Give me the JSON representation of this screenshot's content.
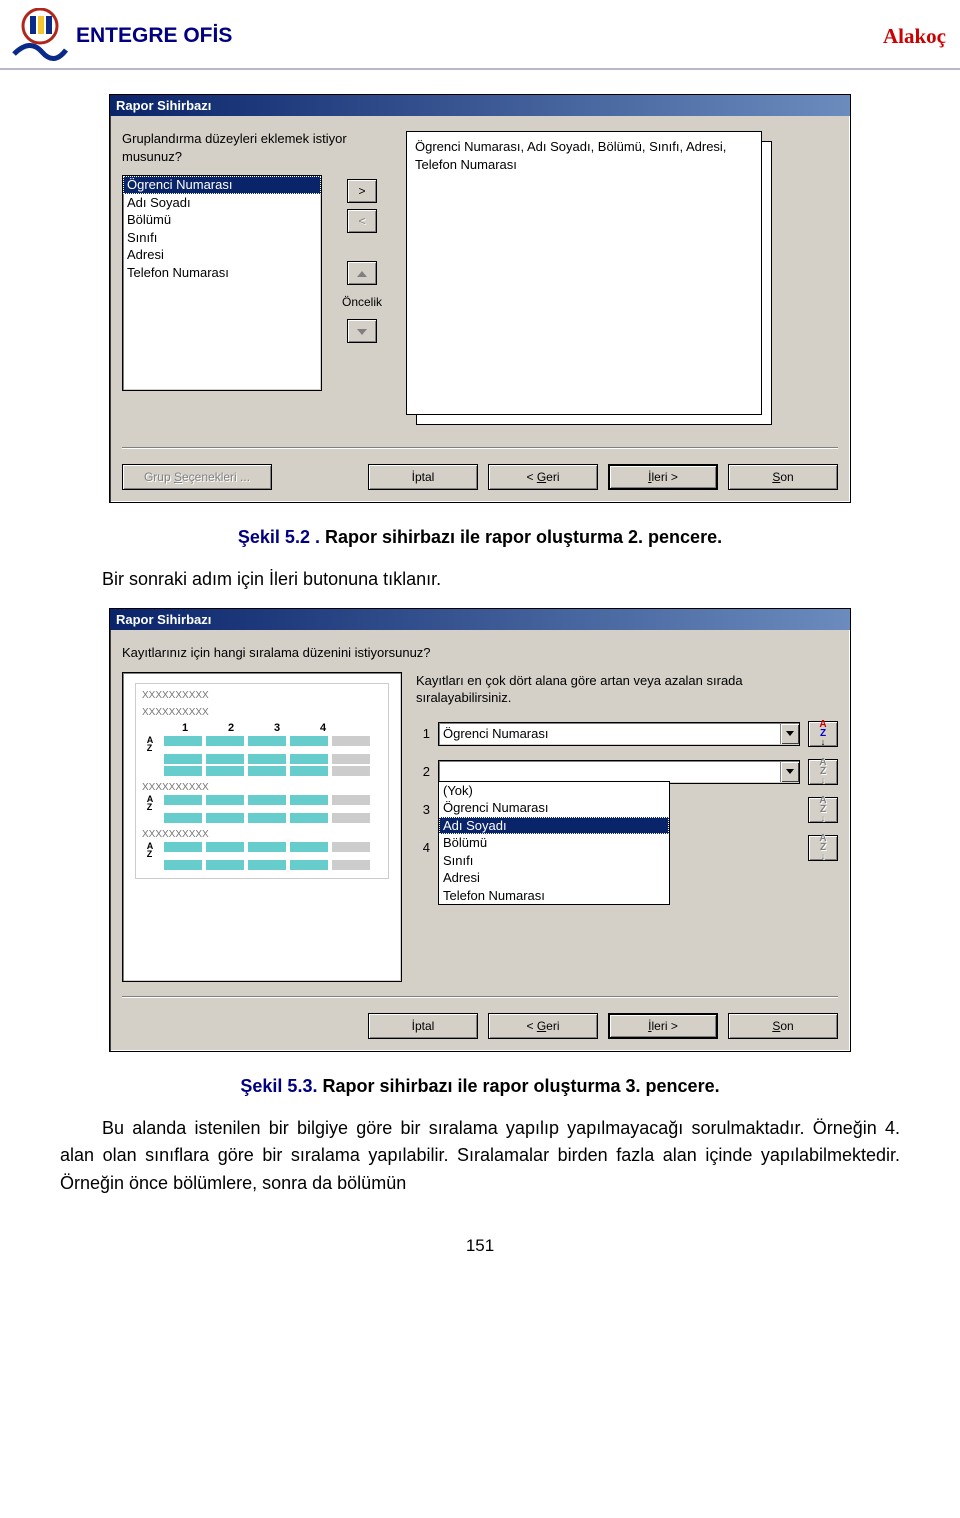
{
  "header": {
    "left": "ENTEGRE OFİS",
    "right": "Alakoç"
  },
  "dialog1": {
    "title": "Rapor Sihirbazı",
    "question": "Gruplandırma düzeyleri eklemek istiyor musunuz?",
    "fields": [
      "Ögrenci Numarası",
      "Adı Soyadı",
      "Bölümü",
      "Sınıfı",
      "Adresi",
      "Telefon Numarası"
    ],
    "preview_line": "Ögrenci Numarası, Adı Soyadı, Bölümü, Sınıfı, Adresi, Telefon Numarası",
    "priority_label": "Öncelik",
    "buttons": {
      "group_options": "Grup Seçenekleri ...",
      "cancel": "İptal",
      "back": "< Geri",
      "next": "İleri >",
      "finish": "Son"
    }
  },
  "caption1": {
    "blue": "Şekil 5.2 .",
    "rest": " Rapor sihirbazı ile rapor oluşturma 2. pencere."
  },
  "text1": "Bir sonraki adım için İleri butonuna tıklanır.",
  "dialog2": {
    "title": "Rapor Sihirbazı",
    "question": "Kayıtlarınız için hangi sıralama düzenini istiyorsunuz?",
    "hint": "Kayıtları en çok dört alana göre artan veya azalan sırada sıralayabilirsiniz.",
    "sort1_value": "Ögrenci Numarası",
    "sort2_value": "",
    "dropdown_options": [
      "(Yok)",
      "Ögrenci Numarası",
      "Adı Soyadı",
      "Bölümü",
      "Sınıfı",
      "Adresi",
      "Telefon Numarası"
    ],
    "dropdown_selected": "Adı Soyadı",
    "preview_placeholder": "XXXXXXXXXX",
    "buttons": {
      "cancel": "İptal",
      "back": "< Geri",
      "next": "İleri >",
      "finish": "Son"
    }
  },
  "caption2": {
    "blue": "Şekil 5.3.",
    "rest": " Rapor sihirbazı ile rapor oluşturma 3. pencere."
  },
  "text2": "Bu alanda istenilen bir bilgiye göre bir sıralama yapılıp yapılmayacağı sorulmaktadır. Örneğin 4. alan olan sınıflara göre bir sıralama yapılabilir. Sıralamalar birden fazla alan içinde yapılabilmektedir. Örneğin önce bölümlere, sonra da bölümün",
  "page_number": "151"
}
